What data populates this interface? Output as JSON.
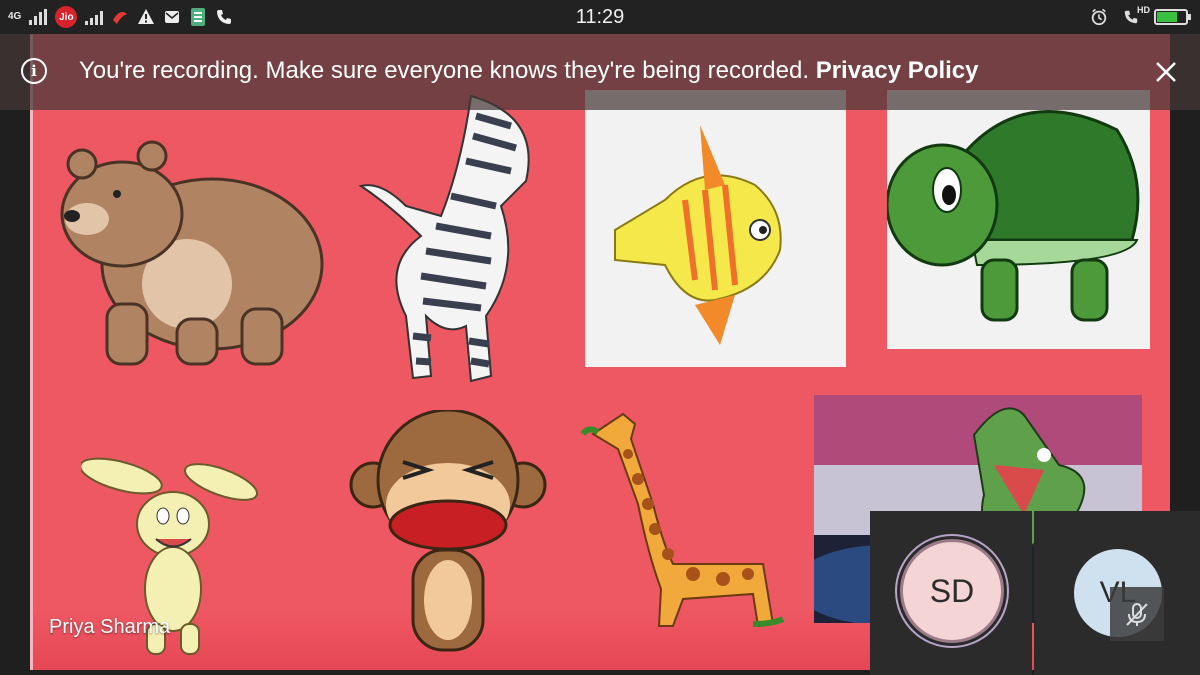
{
  "status_bar": {
    "network": "4G",
    "carrier": "Jio",
    "time": "11:29",
    "hd": "HD",
    "battery_level": 0.72
  },
  "banner": {
    "message": "You're recording. Make sure everyone knows they're being recorded.",
    "link": "Privacy Policy"
  },
  "stage": {
    "presenter_name": "Priya Sharma",
    "pictures": [
      "bear",
      "zebra",
      "fish",
      "turtle",
      "rabbit",
      "monkey",
      "giraffe",
      "crocodile"
    ]
  },
  "participants": [
    {
      "initials": "SD",
      "speaking": true,
      "muted": false
    },
    {
      "initials": "VL",
      "speaking": false,
      "muted": true
    }
  ],
  "colors": {
    "stage_bg": "#ee5863",
    "banner_bg": "#463737",
    "battery": "#37c13f",
    "avatar_sd": "#f4d4d4",
    "avatar_vl": "#cfe0ef"
  }
}
